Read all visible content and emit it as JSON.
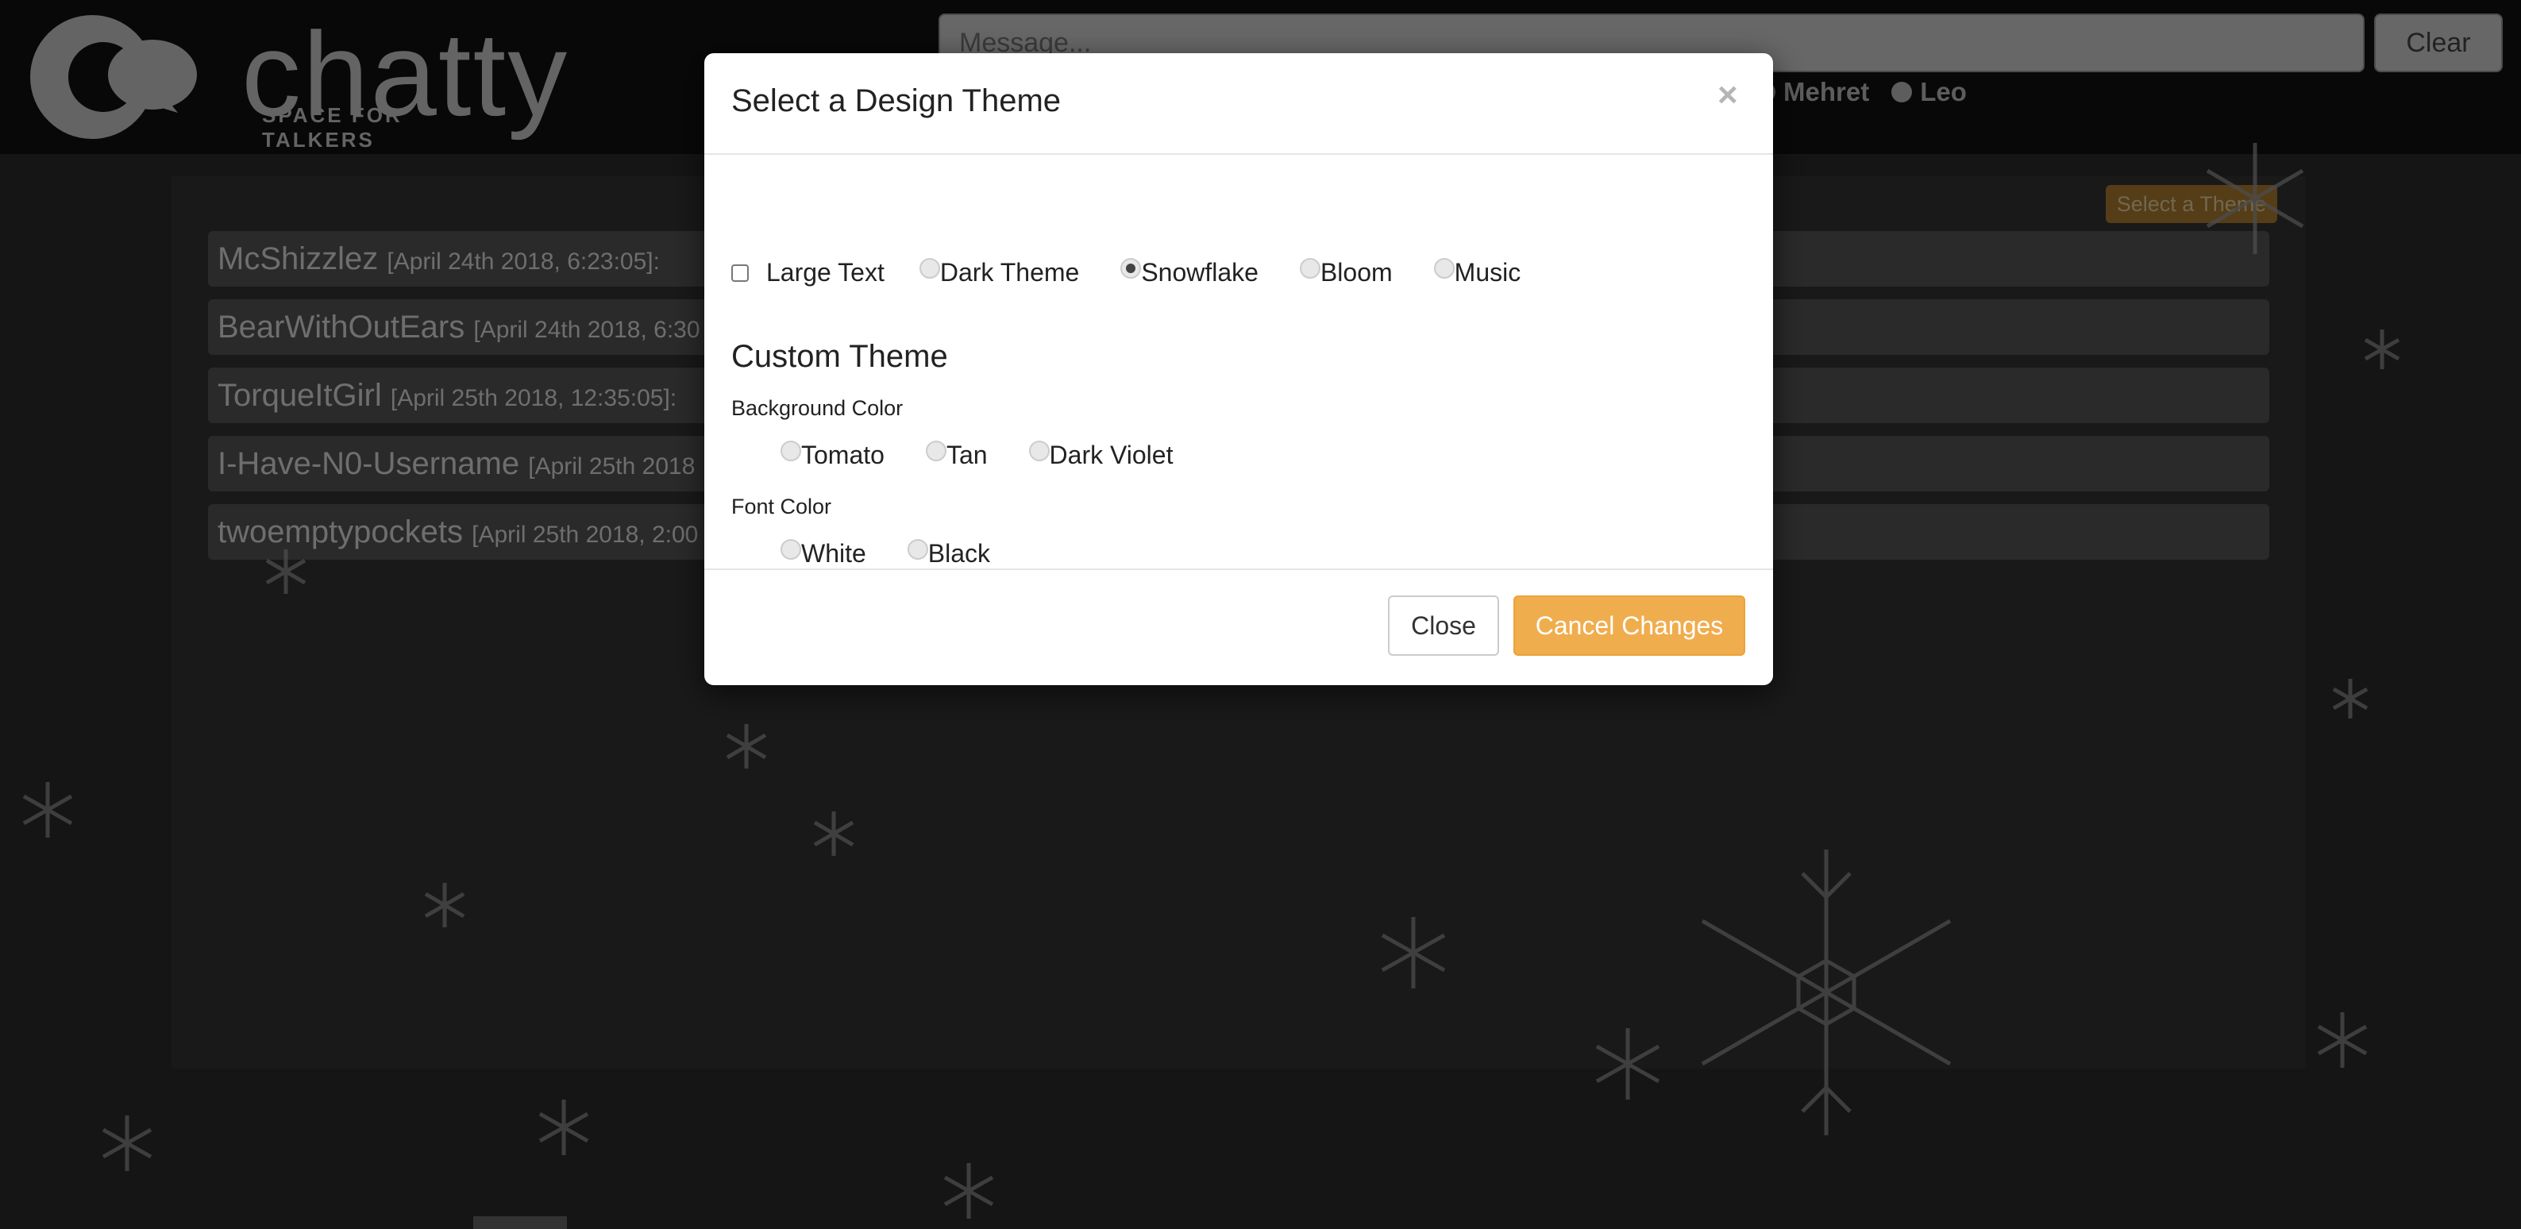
{
  "app": {
    "logo_text": "chatty",
    "logo_tagline": "SPACE FOR TALKERS"
  },
  "header": {
    "message_placeholder": "Message...",
    "clear_label": "Clear",
    "users": [
      "Mehret",
      "Leo"
    ]
  },
  "chat": {
    "theme_button_label": "Select a Theme",
    "messages": [
      {
        "user": "McShizzlez",
        "timestamp": "[April 24th 2018, 6:23:05]:"
      },
      {
        "user": "BearWithOutEars",
        "timestamp": "[April 24th 2018, 6:30"
      },
      {
        "user": "TorqueItGirl",
        "timestamp": "[April 25th 2018, 12:35:05]:"
      },
      {
        "user": "I-Have-N0-Username",
        "timestamp": "[April 25th 2018"
      },
      {
        "user": "twoemptypockets",
        "timestamp": "[April 25th 2018, 2:00"
      }
    ]
  },
  "modal": {
    "title": "Select a Design Theme",
    "close_glyph": "×",
    "large_text_label": "Large Text",
    "large_text_checked": false,
    "themes": [
      {
        "label": "Dark Theme",
        "checked": false
      },
      {
        "label": "Snowflake",
        "checked": true
      },
      {
        "label": "Bloom",
        "checked": false
      },
      {
        "label": "Music",
        "checked": false
      }
    ],
    "custom_theme_title": "Custom Theme",
    "background_color_label": "Background Color",
    "background_colors": [
      {
        "label": "Tomato",
        "checked": false
      },
      {
        "label": "Tan",
        "checked": false
      },
      {
        "label": "Dark Violet",
        "checked": false
      }
    ],
    "font_color_label": "Font Color",
    "font_colors": [
      {
        "label": "White",
        "checked": false
      },
      {
        "label": "Black",
        "checked": false
      }
    ],
    "close_button_label": "Close",
    "cancel_button_label": "Cancel Changes"
  },
  "colors": {
    "accent": "#f0ad4e",
    "overlay": "#000000",
    "panel": "#333333"
  }
}
